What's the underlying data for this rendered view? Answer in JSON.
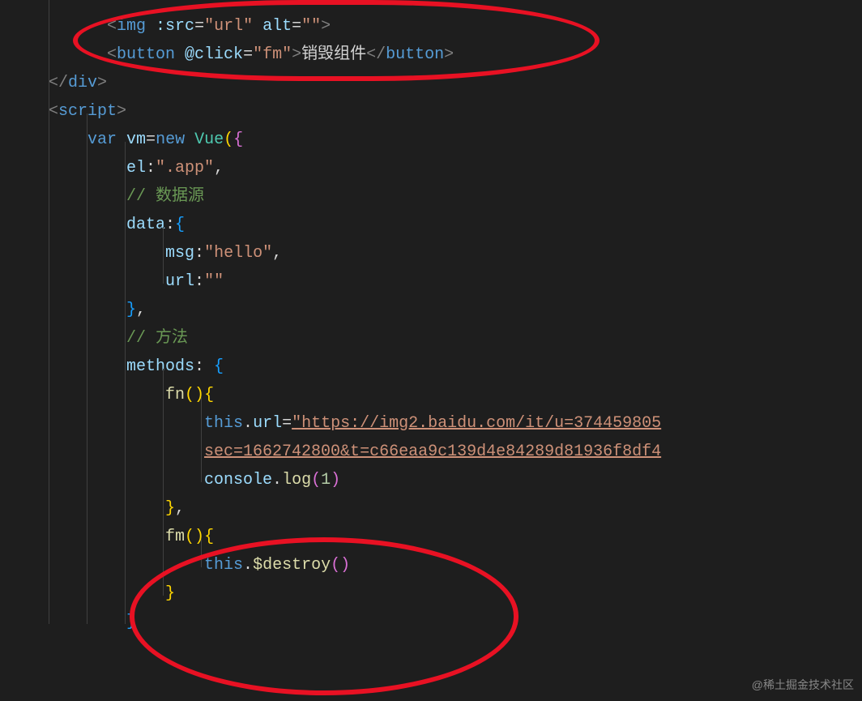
{
  "code": {
    "l1_open": "<",
    "l1_tag": "img",
    "l1_attr1": " :src",
    "l1_eq1": "=",
    "l1_val1": "\"url\"",
    "l1_attr2": " alt",
    "l1_eq2": "=",
    "l1_val2": "\"\"",
    "l1_close": ">",
    "l2_open": "<",
    "l2_tag": "button",
    "l2_attr1": " @click",
    "l2_eq1": "=",
    "l2_val1": "\"fm\"",
    "l2_close1": ">",
    "l2_text": "销毁组件",
    "l2_open2": "</",
    "l2_tag2": "button",
    "l2_close2": ">",
    "l3_open": "</",
    "l3_tag": "div",
    "l3_close": ">",
    "l4_open": "<",
    "l4_tag": "script",
    "l4_close": ">",
    "l5_var": "var",
    "l5_vm": " vm",
    "l5_eq": "=",
    "l5_new": "new",
    "l5_vue": " Vue",
    "l5_paren_open": "(",
    "l5_brace_open": "{",
    "l6_prop": "el",
    "l6_colon": ":",
    "l6_val": "\".app\"",
    "l6_comma": ",",
    "l7_comment": "// 数据源",
    "l8_prop": "data",
    "l8_colon": ":",
    "l8_brace": "{",
    "l9_prop": "msg",
    "l9_colon": ":",
    "l9_val": "\"hello\"",
    "l9_comma": ",",
    "l10_prop": "url",
    "l10_colon": ":",
    "l10_val": "\"\"",
    "l11_brace": "}",
    "l11_comma": ",",
    "l12_comment": "// 方法",
    "l13_prop": "methods",
    "l13_colon": ": ",
    "l13_brace": "{",
    "l14_fn": "fn",
    "l14_paren": "()",
    "l14_brace": "{",
    "l15_this": "this",
    "l15_dot": ".",
    "l15_prop": "url",
    "l15_eq": "=",
    "l15_val": "\"https://img2.baidu.com/it/u=374459805",
    "l16_val": "sec=1662742800&t=c66eaa9c139d4e84289d81936f8df4",
    "l17_console": "console",
    "l17_dot": ".",
    "l17_log": "log",
    "l17_paren_open": "(",
    "l17_num": "1",
    "l17_paren_close": ")",
    "l18_brace": "}",
    "l18_comma": ",",
    "l19_fn": "fm",
    "l19_paren": "()",
    "l19_brace": "{",
    "l20_this": "this",
    "l20_dot": ".",
    "l20_destroy": "$destroy",
    "l20_paren": "()",
    "l21_brace": "}",
    "l22_brace": "}"
  },
  "watermark": "@稀土掘金技术社区"
}
